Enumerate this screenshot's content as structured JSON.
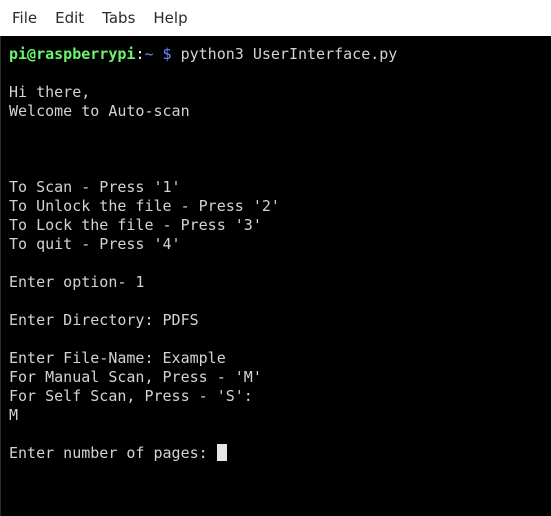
{
  "menu": {
    "file": "File",
    "edit": "Edit",
    "tabs": "Tabs",
    "help": "Help"
  },
  "prompt": {
    "user_host": "pi@raspberrypi",
    "separator": ":",
    "path": "~",
    "symbol": "$",
    "command": "python3 UserInterface.py"
  },
  "output": {
    "greeting": "Hi there,",
    "welcome": "Welcome to Auto-scan",
    "option1": "To Scan - Press '1'",
    "option2": "To Unlock the file - Press '2'",
    "option3": "To Lock the file - Press '3'",
    "option4": "To quit - Press '4'",
    "enter_option": "Enter option- 1",
    "enter_directory": "Enter Directory: PDFS",
    "enter_filename": "Enter File-Name: Example",
    "manual_scan": "For Manual Scan, Press - 'M'",
    "self_scan": "For Self Scan, Press - 'S':",
    "scan_choice": "M",
    "enter_pages": "Enter number of pages: "
  },
  "colors": {
    "terminal_bg": "#000000",
    "terminal_text": "#d3d3d3",
    "prompt_user": "#6cf56c",
    "prompt_path": "#6b8cff"
  }
}
